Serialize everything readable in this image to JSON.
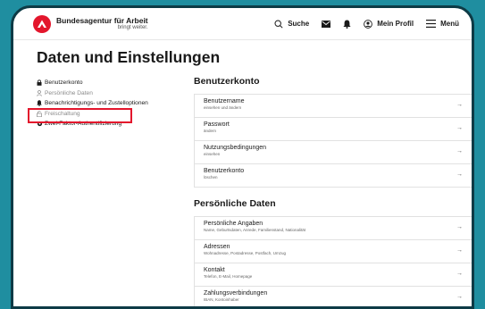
{
  "header": {
    "brand_name": "Bundesagentur für Arbeit",
    "brand_tagline": "bringt weiter.",
    "search_label": "Suche",
    "profile_label": "Mein Profil",
    "menu_label": "Menü"
  },
  "page": {
    "title": "Daten und Einstellungen"
  },
  "sidebar": {
    "items": [
      {
        "label": "Benutzerkonto",
        "icon": "lock-icon"
      },
      {
        "label": "Persönliche Daten",
        "icon": "person-icon"
      },
      {
        "label": "Benachrichtigungs- und Zustelloptionen",
        "icon": "bell-icon"
      },
      {
        "label": "Freischaltung",
        "icon": "unlock-icon"
      },
      {
        "label": "Zwei-Faktor-Authentifizierung",
        "icon": "gear-icon"
      }
    ],
    "highlighted_item": "Freischaltung"
  },
  "sections": [
    {
      "title": "Benutzerkonto",
      "rows": [
        {
          "label": "Benutzername",
          "sub": "einsehen und ändern"
        },
        {
          "label": "Passwort",
          "sub": "ändern"
        },
        {
          "label": "Nutzungsbedingungen",
          "sub": "einsehen"
        },
        {
          "label": "Benutzerkonto",
          "sub": "löschen"
        }
      ]
    },
    {
      "title": "Persönliche Daten",
      "rows": [
        {
          "label": "Persönliche Angaben",
          "sub": "Name, Geburtsdaten, Anrede, Familienstand, Nationalität"
        },
        {
          "label": "Adressen",
          "sub": "Wohnadresse, Postadresse, Postfach, Umzug"
        },
        {
          "label": "Kontakt",
          "sub": "Telefon, E-Mail, Homepage"
        },
        {
          "label": "Zahlungsverbindungen",
          "sub": "IBAN, Kontoinhaber"
        }
      ]
    }
  ],
  "colors": {
    "brand_red": "#e3162c",
    "frame": "#0d3b46",
    "background": "#1f8ea0"
  }
}
